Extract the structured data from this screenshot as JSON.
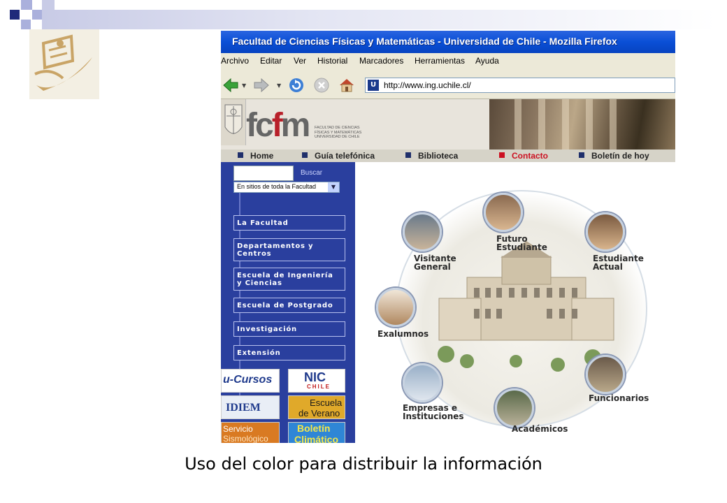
{
  "slide": {
    "caption": "Uso del color para distribuir la información"
  },
  "browser": {
    "title": "Facultad de Ciencias Físicas y Matemáticas - Universidad de Chile - Mozilla Firefox",
    "menu": [
      "Archivo",
      "Editar",
      "Ver",
      "Historial",
      "Marcadores",
      "Herramientas",
      "Ayuda"
    ],
    "address": "http://www.ing.uchile.cl/",
    "toolbar_icons": [
      "back-arrow-icon",
      "forward-arrow-icon",
      "reload-icon",
      "stop-icon",
      "home-icon"
    ]
  },
  "site": {
    "logo": "fcfm",
    "logo_subtitle": [
      "FACULTAD DE CIENCIAS",
      "FÍSICAS Y MATEMÁTICAS",
      "UNIVERSIDAD DE CHILE"
    ],
    "nav": [
      {
        "label": "Home",
        "active": false
      },
      {
        "label": "Guía telefónica",
        "active": false
      },
      {
        "label": "Biblioteca",
        "active": false
      },
      {
        "label": "Contacto",
        "active": true
      },
      {
        "label": "Boletín de hoy",
        "active": false
      }
    ],
    "search": {
      "button": "Buscar",
      "scope": "En sitios de toda la Facultad"
    },
    "sidebar_menu": [
      [
        "La Facultad"
      ],
      [
        "Departamentos y",
        "Centros"
      ],
      [
        "Escuela de Ingeniería",
        "y Ciencias"
      ],
      [
        "Escuela de Postgrado"
      ],
      [
        "Investigación"
      ],
      [
        "Extensión"
      ]
    ],
    "banners": {
      "cursos": "u-Cursos",
      "nic": "NIC",
      "nic_sub": "CHILE",
      "idiem": "IDIEM",
      "verano": [
        "Escuela",
        "de Verano"
      ],
      "servicio": [
        "Servicio",
        "Sismológico"
      ],
      "boletin": [
        "Boletín",
        "Climático"
      ]
    },
    "audiences": [
      [
        "Futuro",
        "Estudiante"
      ],
      [
        "Visitante",
        "General"
      ],
      [
        "Estudiante",
        "Actual"
      ],
      [
        "Exalumnos"
      ],
      [
        "Funcionarios"
      ],
      [
        "Empresas e",
        "Instituciones"
      ],
      [
        "Académicos"
      ]
    ],
    "colors": {
      "nav_active": "#cc1122",
      "sidebar": "#2a3f9e",
      "titlebar": "#0a4fd6"
    }
  }
}
